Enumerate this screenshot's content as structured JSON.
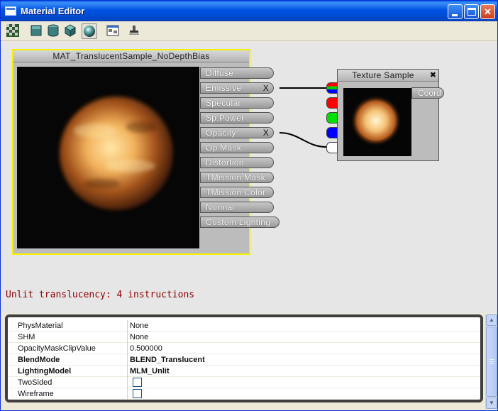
{
  "window": {
    "title": "Material Editor",
    "minimize_label": "_",
    "maximize_label": "□",
    "close_label": "✕"
  },
  "toolbar": {
    "tools": [
      {
        "icon": "checker-background-icon"
      },
      {
        "icon": "preview-plane-icon"
      },
      {
        "icon": "preview-cylinder-icon"
      },
      {
        "icon": "preview-cube-icon"
      },
      {
        "icon": "preview-sphere-icon",
        "pressed": true
      },
      {
        "icon": "expression-window-icon"
      },
      {
        "icon": "home-position-icon"
      }
    ]
  },
  "material_node": {
    "title": "MAT_TranslucentSample_NoDepthBias",
    "inputs": [
      {
        "label": "Diffuse",
        "connected": false
      },
      {
        "label": "Emissive",
        "connected": true,
        "remove_label": "X"
      },
      {
        "label": "Specular",
        "connected": false
      },
      {
        "label": "Sp.Power",
        "connected": false
      },
      {
        "label": "Opacity",
        "connected": true,
        "remove_label": "X"
      },
      {
        "label": "Op.Mask",
        "connected": false
      },
      {
        "label": "Distortion",
        "connected": false
      },
      {
        "label": "TMission Mask",
        "connected": false
      },
      {
        "label": "TMission Color",
        "connected": false
      },
      {
        "label": "Normal",
        "connected": false
      },
      {
        "label": "Custom Lighting",
        "connected": false
      }
    ]
  },
  "texture_node": {
    "title": "Texture Sample",
    "close_label": "✖",
    "input_label": "Coord",
    "output_colors": [
      "#rgb",
      "#ff0000",
      "#00ff00",
      "#0000ff",
      "#ffffff"
    ]
  },
  "status": {
    "text": "Unlit translucency: 4 instructions",
    "color": "#900000"
  },
  "properties": [
    {
      "name": "PhysMaterial",
      "value": "None",
      "bold": false
    },
    {
      "name": "SHM",
      "value": "None",
      "bold": false
    },
    {
      "name": "OpacityMaskClipValue",
      "value": "0.500000",
      "bold": false
    },
    {
      "name": "BlendMode",
      "value": "BLEND_Translucent",
      "bold": true
    },
    {
      "name": "LightingModel",
      "value": "MLM_Unlit",
      "bold": true
    },
    {
      "name": "TwoSided",
      "checkbox": true,
      "checked": false,
      "bold": false
    },
    {
      "name": "Wireframe",
      "checkbox": true,
      "checked": false,
      "bold": false
    }
  ]
}
